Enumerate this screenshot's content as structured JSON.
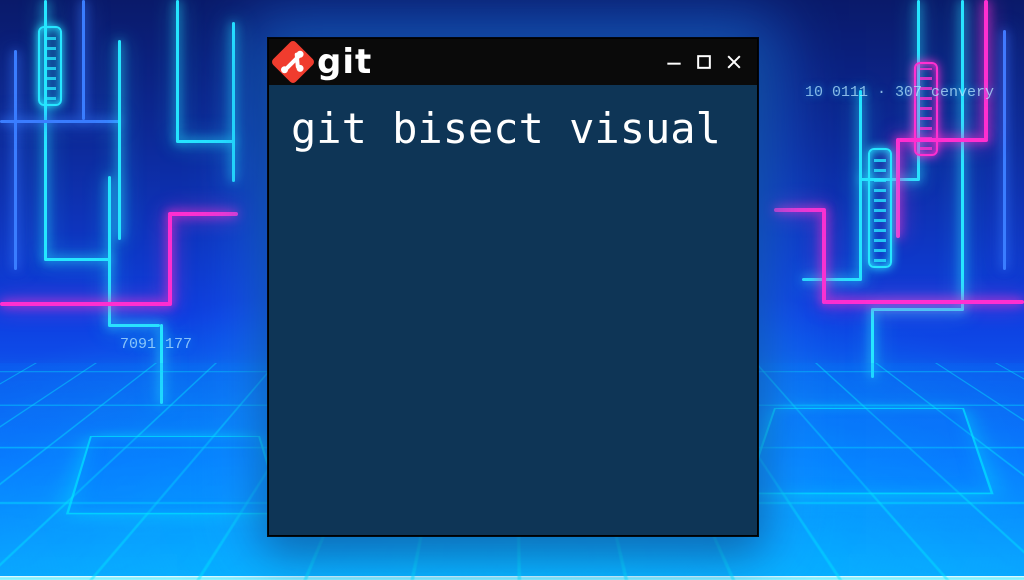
{
  "window": {
    "brand_text": "git",
    "controls": {
      "minimize_tip": "Minimize",
      "maximize_tip": "Maximize",
      "close_tip": "Close"
    }
  },
  "terminal": {
    "command": "git bisect visual"
  },
  "background": {
    "ghost_left": "7091 177",
    "ghost_right": "10 0111 · 307  cenvery"
  },
  "colors": {
    "window_bg": "#0e3556",
    "titlebar_bg": "#0a0a0a",
    "git_logo": "#f03c2e",
    "neon_cyan": "#26e6ff",
    "neon_magenta": "#ff2fd0"
  }
}
